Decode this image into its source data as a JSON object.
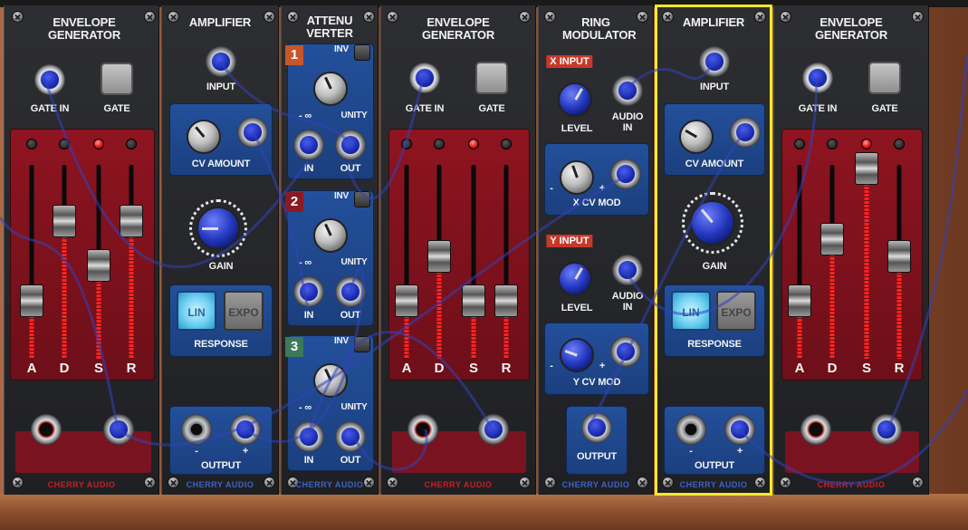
{
  "brand": "CHERRY AUDIO",
  "colors": {
    "accent_select": "#f2ea2c",
    "panel_red": "#8e1420",
    "panel_blue": "#23509b",
    "jack_plug": "#1a2bb0"
  },
  "env1": {
    "title": "ENVELOPE GENERATOR",
    "gate_in": "GATE IN",
    "gate": "GATE",
    "sliders": [
      "A",
      "D",
      "S",
      "R"
    ],
    "levels": [
      0.25,
      0.7,
      0.45,
      0.7
    ],
    "leds": [
      false,
      false,
      true,
      false
    ]
  },
  "amp1": {
    "title": "AMPLIFIER",
    "input": "INPUT",
    "cv": "CV AMOUNT",
    "gain": "GAIN",
    "lin": "LIN",
    "expo": "EXPO",
    "response": "RESPONSE",
    "output": "OUTPUT",
    "minus": "-",
    "plus": "+",
    "selected": false
  },
  "att": {
    "title": "ATTENU VERTER",
    "channels": [
      {
        "num": "1",
        "inv": "INV",
        "neg": "- ∞",
        "unity": "UNITY",
        "in": "IN",
        "out": "OUT",
        "color": "#c8562a"
      },
      {
        "num": "2",
        "inv": "INV",
        "neg": "- ∞",
        "unity": "UNITY",
        "in": "IN",
        "out": "OUT",
        "color": "#8b1a22"
      },
      {
        "num": "3",
        "inv": "INV",
        "neg": "- ∞",
        "unity": "UNITY",
        "in": "IN",
        "out": "OUT",
        "color": "#3a7a5a"
      }
    ]
  },
  "env2": {
    "title": "ENVELOPE GENERATOR",
    "gate_in": "GATE IN",
    "gate": "GATE",
    "sliders": [
      "A",
      "D",
      "S",
      "R"
    ],
    "levels": [
      0.25,
      0.5,
      0.25,
      0.25
    ],
    "leds": [
      false,
      false,
      true,
      false
    ]
  },
  "ring": {
    "title": "RING MODULATOR",
    "x_input": "X INPUT",
    "y_input": "Y INPUT",
    "level": "LEVEL",
    "audio_in": "AUDIO IN",
    "x_cv": "X CV MOD",
    "y_cv": "Y CV MOD",
    "output": "OUTPUT",
    "minus": "-",
    "plus": "+"
  },
  "amp2": {
    "title": "AMPLIFIER",
    "input": "INPUT",
    "cv": "CV AMOUNT",
    "gain": "GAIN",
    "lin": "LIN",
    "expo": "EXPO",
    "response": "RESPONSE",
    "output": "OUTPUT",
    "minus": "-",
    "plus": "+",
    "selected": true
  },
  "env3": {
    "title": "ENVELOPE GENERATOR",
    "gate_in": "GATE IN",
    "gate": "GATE",
    "sliders": [
      "A",
      "D",
      "S",
      "R"
    ],
    "levels": [
      0.25,
      0.6,
      1.0,
      0.5
    ],
    "leds": [
      false,
      false,
      true,
      false
    ]
  }
}
